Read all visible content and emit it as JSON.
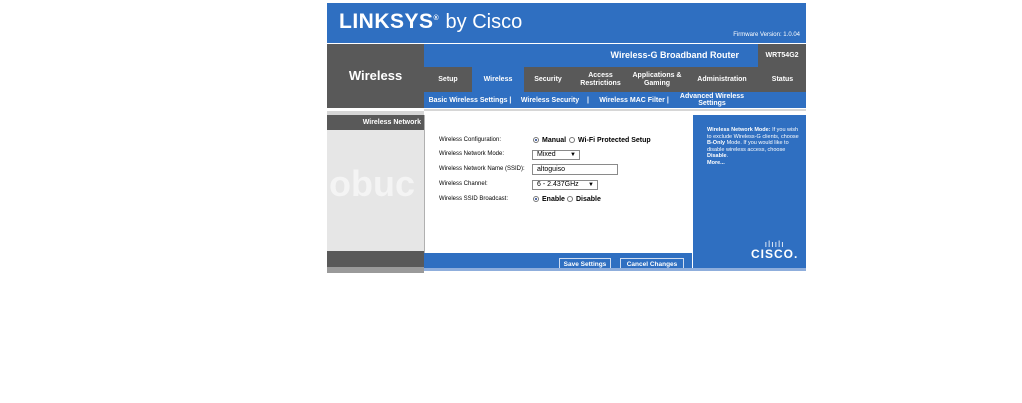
{
  "header": {
    "brand": "LINKSYS",
    "brand_suffix": "by Cisco",
    "registered_mark": "®",
    "firmware": "Firmware Version: 1.0.04"
  },
  "section_title": "Wireless",
  "product": {
    "name": "Wireless-G Broadband Router",
    "model": "WRT54G2"
  },
  "tabs": [
    {
      "label": "Setup"
    },
    {
      "label": "Wireless"
    },
    {
      "label": "Security"
    },
    {
      "label": "Access Restrictions"
    },
    {
      "label": "Applications & Gaming"
    },
    {
      "label": "Administration"
    },
    {
      "label": "Status"
    }
  ],
  "subtabs": [
    {
      "label": "Basic Wireless Settings  |"
    },
    {
      "label": "Wireless Security"
    },
    {
      "label": "|"
    },
    {
      "label": "Wireless MAC Filter  |"
    },
    {
      "label": "Advanced Wireless Settings"
    }
  ],
  "sidebar": {
    "heading": "Wireless Network",
    "watermark": "obuc"
  },
  "form": {
    "config_label": "Wireless Configuration:",
    "config_manual": "Manual",
    "config_wps": "Wi-Fi Protected Setup",
    "mode_label": "Wireless Network Mode:",
    "mode_value": "Mixed",
    "ssid_label": "Wireless Network Name (SSID):",
    "ssid_value": "altoguiso",
    "channel_label": "Wireless Channel:",
    "channel_value": "6 - 2.437GHz",
    "broadcast_label": "Wireless SSID Broadcast:",
    "broadcast_enable": "Enable",
    "broadcast_disable": "Disable"
  },
  "help": {
    "title": "Wireless Network Mode:",
    "line1": "If you wish to exclude Wireless-G clients, choose",
    "bonly": "B-Only",
    "line2": "Mode. If you would like to disable wireless access, choose",
    "disable": "Disable",
    "more": "More...",
    "cisco_bars": "ılıılı",
    "cisco_word": "CISCO."
  },
  "buttons": {
    "save": "Save Settings",
    "cancel": "Cancel Changes"
  },
  "colors": {
    "brand_blue": "#2f6fc1",
    "dark_gray": "#595959"
  }
}
